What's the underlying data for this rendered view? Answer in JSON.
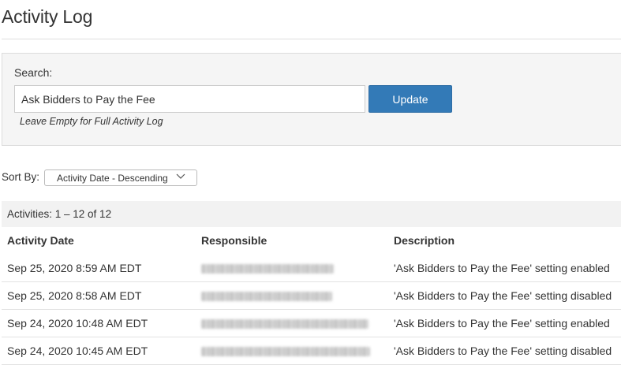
{
  "page": {
    "title": "Activity Log"
  },
  "search": {
    "label": "Search:",
    "value": "Ask Bidders to Pay the Fee",
    "update_label": "Update",
    "hint": "Leave Empty for Full Activity Log"
  },
  "sort": {
    "label": "Sort By:",
    "selected": "Activity Date - Descending"
  },
  "activities": {
    "count_text": "Activities: 1 – 12 of 12",
    "columns": {
      "date": "Activity Date",
      "responsible": "Responsible",
      "description": "Description"
    },
    "rows": [
      {
        "date": "Sep 25, 2020 8:59 AM EDT",
        "description": "'Ask Bidders to Pay the Fee' setting enabled"
      },
      {
        "date": "Sep 25, 2020 8:58 AM EDT",
        "description": "'Ask Bidders to Pay the Fee' setting disabled"
      },
      {
        "date": "Sep 24, 2020 10:48 AM EDT",
        "description": "'Ask Bidders to Pay the Fee' setting enabled"
      },
      {
        "date": "Sep 24, 2020 10:45 AM EDT",
        "description": "'Ask Bidders to Pay the Fee' setting disabled"
      }
    ]
  },
  "icons": {
    "sort_chevron": "chevron-down-icon"
  },
  "colors": {
    "primary_button": "#337ab7",
    "panel_bg": "#f5f5f5"
  }
}
